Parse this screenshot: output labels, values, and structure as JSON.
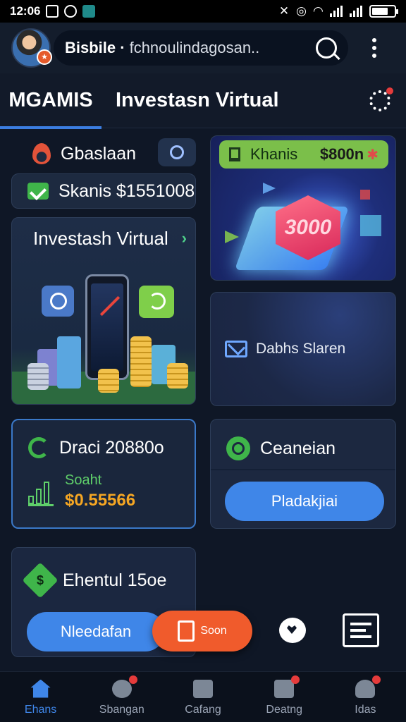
{
  "status_bar": {
    "time": "12:06"
  },
  "header": {
    "brand": "Bisbile ·",
    "subtitle": "fchnoulindagosan.."
  },
  "tabs": [
    {
      "label": "MGAMIS"
    },
    {
      "label": "Investasn Virtual"
    }
  ],
  "left": {
    "gbaslaan_label": "Gbaslaan",
    "skanis_label": "Skanis $1551008",
    "invest_card_title": "Investash Virtual",
    "draci_label": "Draci 20880o",
    "draci_sub": "Soaht",
    "draci_amount": "$0.55566",
    "ehentul_label": "Ehentul 15oe",
    "ehentul_button": "Nleedafan",
    "orange_button": "Soon"
  },
  "right": {
    "khanis_label": "Khanis",
    "khanis_value": "$800n",
    "hero_badge": "3000",
    "dabhs_label": "Dabhs Slaren",
    "ceaneian_label": "Ceaneian",
    "ceaneian_button": "Pladakjiai"
  },
  "bottom_nav": [
    {
      "label": "Ehans",
      "icon": "home-icon"
    },
    {
      "label": "Sbangan",
      "icon": "profile-alert-icon"
    },
    {
      "label": "Cafang",
      "icon": "edit-icon"
    },
    {
      "label": "Deatng",
      "icon": "document-icon"
    },
    {
      "label": "Idas",
      "icon": "user-icon"
    }
  ],
  "colors": {
    "accent": "#3f86e8",
    "success": "#3fb54a",
    "warning": "#f05b2c",
    "background": "#0f1726"
  }
}
